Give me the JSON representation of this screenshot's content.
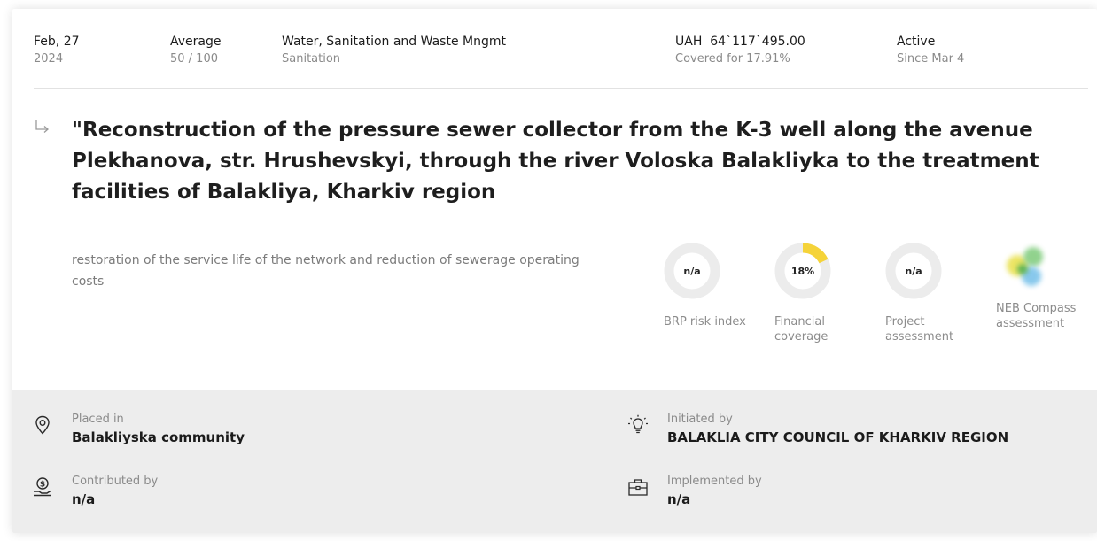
{
  "meta": {
    "date_main": "Feb, 27",
    "date_sub": "2024",
    "rating_main": "Average",
    "rating_sub": "50 / 100",
    "sector_main": "Water, Sanitation and Waste Mngmt",
    "sector_sub": "Sanitation",
    "budget_main": "UAH  64`117`495.00",
    "budget_sub": "Covered for 17.91%",
    "status_main": "Active",
    "status_sub": "Since Mar 4"
  },
  "project": {
    "title": "\"Reconstruction of the pressure sewer collector from the K-3 well along the avenue Plekhanova, str. Hrushevskyi, through the river Voloska Balakliyka to the treatment facilities of Balakliya, Kharkiv region",
    "description": "restoration of the service life of the network and reduction of sewerage operating costs"
  },
  "metrics": [
    {
      "value_text": "n/a",
      "label": "BRP risk index",
      "fraction": 0
    },
    {
      "value_text": "18%",
      "label": "Financial coverage",
      "fraction": 0.18
    },
    {
      "value_text": "n/a",
      "label": "Project assessment",
      "fraction": 0
    },
    {
      "label": "NEB Compass assessment"
    }
  ],
  "footer": {
    "placed_label": "Placed in",
    "placed_value": "Balakliyska community",
    "initiated_label": "Initiated by",
    "initiated_value": "BALAKLIA CITY COUNCIL OF KHARKIV REGION",
    "contributed_label": "Contributed by",
    "contributed_value": "n/a",
    "implemented_label": "Implemented by",
    "implemented_value": "n/a"
  },
  "icons": {
    "row_arrow": "return-arrow-icon",
    "placed": "location-pin-icon",
    "initiated": "lightbulb-icon",
    "contributed": "money-hand-icon",
    "implemented": "briefcase-icon"
  },
  "colors": {
    "donut_track": "#ececec",
    "donut_fill": "#f5d339",
    "footer_bg": "#ededed"
  }
}
